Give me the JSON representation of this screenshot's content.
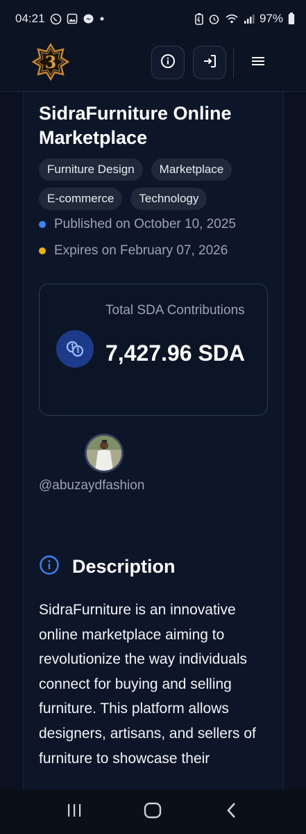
{
  "status_bar": {
    "time": "04:21",
    "battery": "97%",
    "notification_icons": [
      "whatsapp-icon",
      "gallery-icon",
      "messenger-icon",
      "dot-icon"
    ],
    "system_icons": [
      "battery-saver-icon",
      "alarm-icon",
      "wifi-icon",
      "signal-icon",
      "battery-icon"
    ]
  },
  "header": {
    "logo_icon": "sidra-logo-icon",
    "info_icon": "info-icon",
    "login_icon": "login-icon",
    "menu_icon": "hamburger-menu-icon"
  },
  "project": {
    "title": "SidraFurniture Online Marketplace",
    "tags": [
      "Furniture Design",
      "Marketplace",
      "E-commerce",
      "Technology"
    ],
    "published": "Published on October 10, 2025",
    "expires": "Expires on February 07, 2026",
    "published_dot_color": "#3b82f6",
    "expires_dot_color": "#eab308"
  },
  "contributions": {
    "label": "Total SDA Contributions",
    "value": "7,427.96 SDA",
    "icon": "coins-icon"
  },
  "creator": {
    "username": "@abuzaydfashion"
  },
  "description": {
    "heading": "Description",
    "icon": "info-circle-icon",
    "text": "SidraFurniture is an innovative online marketplace aiming to revolutionize the way individuals connect for buying and selling furniture. This platform allows designers, artisans, and sellers of furniture to showcase their"
  },
  "nav_bar": {
    "recents_icon": "recents-icon",
    "home_icon": "home-icon",
    "back_icon": "back-icon"
  },
  "colors": {
    "background": "#0b1120",
    "accent_blue": "#3b82f6",
    "accent_gold": "#c8862e",
    "tag_bg": "#1f293a"
  }
}
